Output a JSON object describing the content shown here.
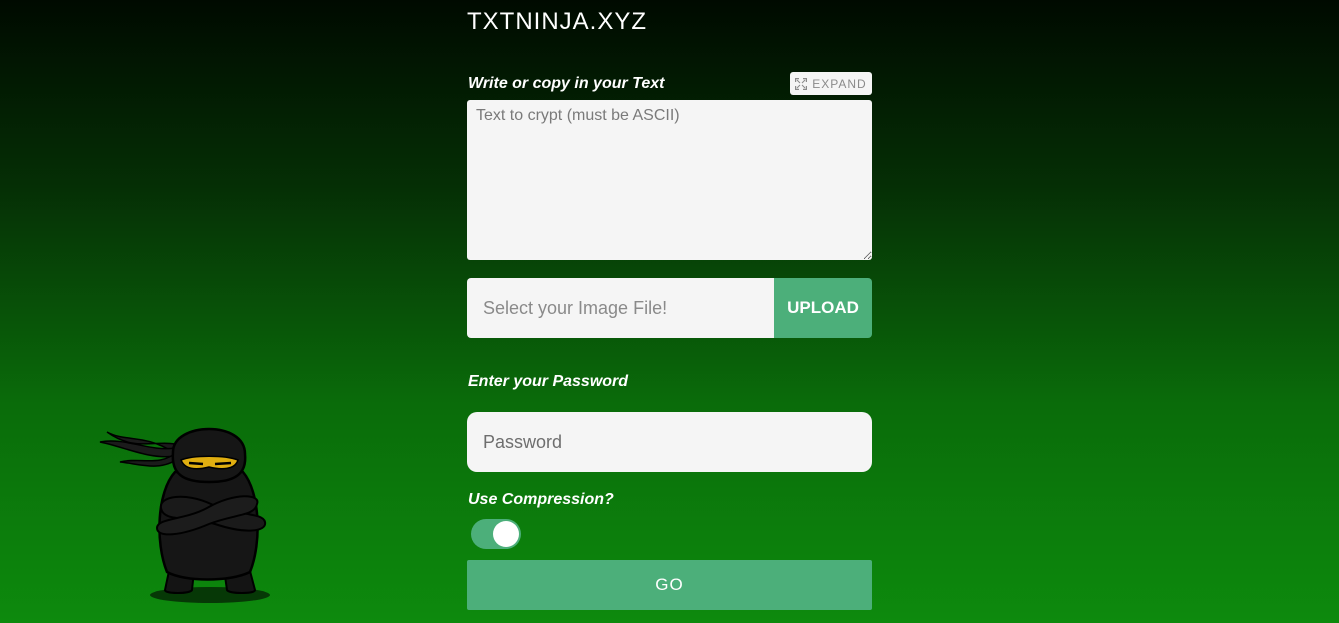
{
  "site": {
    "title": "TXTNINJA.XYZ"
  },
  "text_section": {
    "label": "Write or copy in your Text",
    "expand_label": "EXPAND",
    "expand_icon": "expand-icon",
    "textarea_placeholder": "Text to crypt (must be ASCII)",
    "textarea_value": ""
  },
  "upload": {
    "placeholder": "Select your Image File!",
    "value": "",
    "button_label": "UPLOAD"
  },
  "password": {
    "label": "Enter your Password",
    "placeholder": "Password",
    "value": ""
  },
  "compression": {
    "label": "Use Compression?",
    "enabled": true
  },
  "go": {
    "label": "GO"
  },
  "mascot": {
    "icon": "ninja-mascot"
  },
  "colors": {
    "accent": "#4caf7a",
    "input_bg": "#f5f5f5",
    "background_top": "#000a00",
    "background_bottom": "#0d8a0d"
  }
}
